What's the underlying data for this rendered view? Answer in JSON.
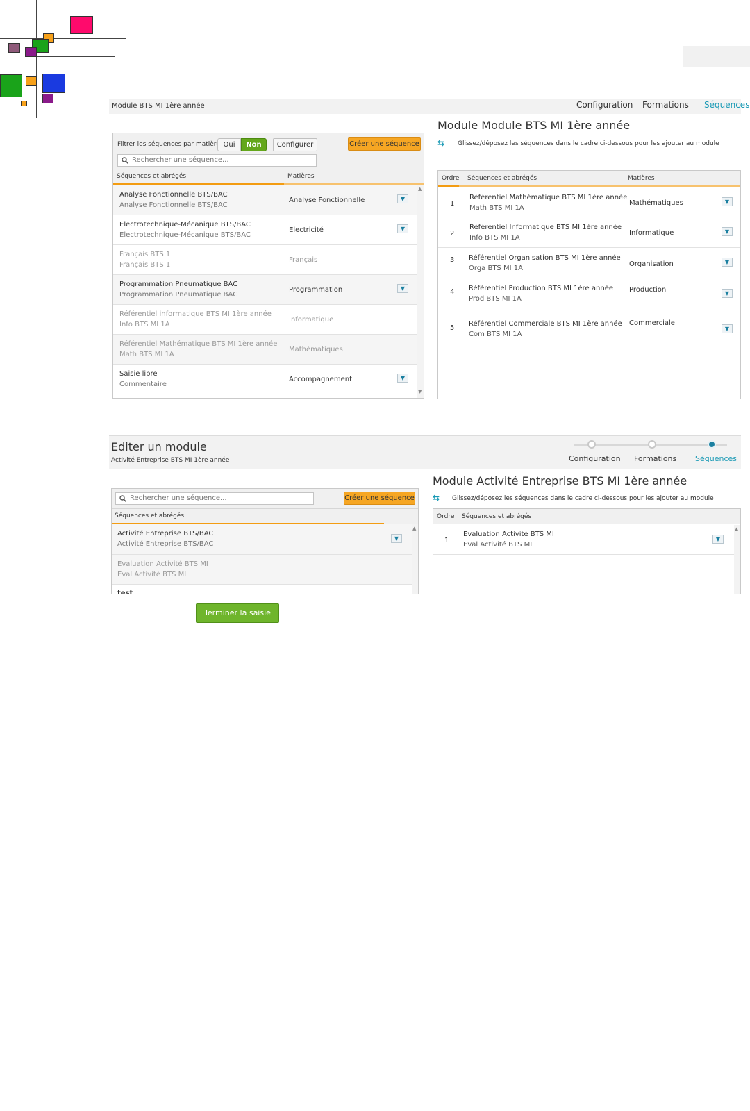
{
  "colors": {
    "accent_teal": "#1a9ab5",
    "orange": "#f6a623",
    "green": "#64a71b",
    "logo_pink": "#ff0a6c",
    "logo_green": "#1aa31a",
    "logo_orange": "#f7a11a",
    "logo_purple": "#8a1a8a",
    "logo_mauve": "#8f5a7a",
    "logo_blue": "#1a3ae0"
  },
  "section1": {
    "module_label": "Module BTS MI 1ère année",
    "nav": [
      "Configuration",
      "Formations",
      "Séquences"
    ],
    "left": {
      "filter_label": "Filtrer les séquences par matière",
      "toggle_yes": "Oui",
      "toggle_no": "Non",
      "configure": "Configurer",
      "create": "Créer une séquence",
      "search_placeholder": "Rechercher une séquence...",
      "col_seq": "Séquences et abrégés",
      "col_mat": "Matières",
      "rows": [
        {
          "name": "Analyse Fonctionnelle BTS/BAC",
          "abbr": "Analyse Fonctionnelle BTS/BAC",
          "matiere": "Analyse Fonctionnelle"
        },
        {
          "name": "Electrotechnique-Mécanique BTS/BAC",
          "abbr": "Electrotechnique-Mécanique BTS/BAC",
          "matiere": "Electricité"
        },
        {
          "name": "Français BTS 1",
          "abbr": "Français BTS 1",
          "matiere": "Français"
        },
        {
          "name": "Programmation Pneumatique BAC",
          "abbr": "Programmation Pneumatique BAC",
          "matiere": "Programmation"
        },
        {
          "name": "Référentiel informatique BTS MI 1ère année",
          "abbr": "Info BTS MI 1A",
          "matiere": "Informatique"
        },
        {
          "name": "Référentiel Mathématique BTS MI 1ère année",
          "abbr": "Math BTS MI 1A",
          "matiere": "Mathématiques"
        },
        {
          "name": "Saisie libre",
          "abbr": "Commentaire",
          "matiere": "Accompagnement"
        }
      ]
    },
    "right": {
      "title": "Module Module BTS MI 1ère année",
      "hint": "Glissez/déposez les séquences dans le cadre ci-dessous pour les ajouter au module",
      "col_ordre": "Ordre",
      "col_seq": "Séquences et abrégés",
      "col_mat": "Matières",
      "rows": [
        {
          "ordre": "1",
          "name": "Référentiel Mathématique BTS MI 1ère année",
          "abbr": "Math BTS MI 1A",
          "matiere": "Mathématiques"
        },
        {
          "ordre": "2",
          "name": "Référentiel Informatique BTS MI 1ère année",
          "abbr": "Info BTS MI 1A",
          "matiere": "Informatique"
        },
        {
          "ordre": "3",
          "name": "Référentiel Organisation   BTS MI 1ère année",
          "abbr": "Orga BTS MI 1A",
          "matiere": "Organisation"
        },
        {
          "ordre": "4",
          "name": "Référentiel Production      BTS MI 1ère année",
          "abbr": "Prod BTS MI 1A",
          "matiere": "Production"
        },
        {
          "ordre": "5",
          "name": "Référentiel  Commerciale  BTS MI 1ère année",
          "abbr": "Com BTS MI 1A",
          "matiere": "Commerciale"
        }
      ]
    }
  },
  "section2": {
    "title": "Editer un module",
    "subtitle": "Activité Entreprise BTS MI 1ère année",
    "steps": [
      "Configuration",
      "Formations",
      "Séquences"
    ],
    "left": {
      "search_placeholder": "Rechercher une séquence...",
      "create": "Créer une séquence",
      "col_seq": "Séquences et abrégés",
      "rows": [
        {
          "name": "Activité Entreprise BTS/BAC",
          "abbr": "Activité Entreprise BTS/BAC"
        },
        {
          "name": "Evaluation Activité BTS MI",
          "abbr": "Eval Activité BTS MI"
        },
        {
          "name": "test",
          "abbr": ""
        }
      ]
    },
    "right": {
      "title": "Module Activité Entreprise BTS MI 1ère année",
      "hint": "Glissez/déposez les séquences dans le cadre ci-dessous pour les ajouter au module",
      "col_ordre": "Ordre",
      "col_seq": "Séquences et abrégés",
      "rows": [
        {
          "ordre": "1",
          "name": "Evaluation Activité BTS MI",
          "abbr": "Eval Activité BTS MI"
        }
      ]
    }
  },
  "finish_button": "Terminer la saisie"
}
